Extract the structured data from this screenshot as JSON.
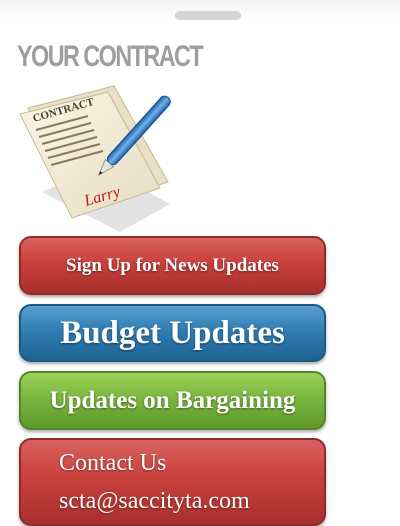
{
  "sidebar": {
    "heading": "YOUR CONTRACT",
    "contract_image": {
      "icon": "contract-signed-icon",
      "paper_label": "CONTRACT",
      "signature": "Larry"
    },
    "buttons": [
      {
        "label": "Sign Up for News Updates",
        "color": "#c9403c"
      },
      {
        "label": "Budget Updates",
        "color": "#2f7db3"
      },
      {
        "label": "Updates on Bargaining",
        "color": "#7bb63e"
      }
    ],
    "contact": {
      "title": "Contact Us",
      "email": "scta@saccityta.com",
      "color": "#c9403c"
    }
  }
}
